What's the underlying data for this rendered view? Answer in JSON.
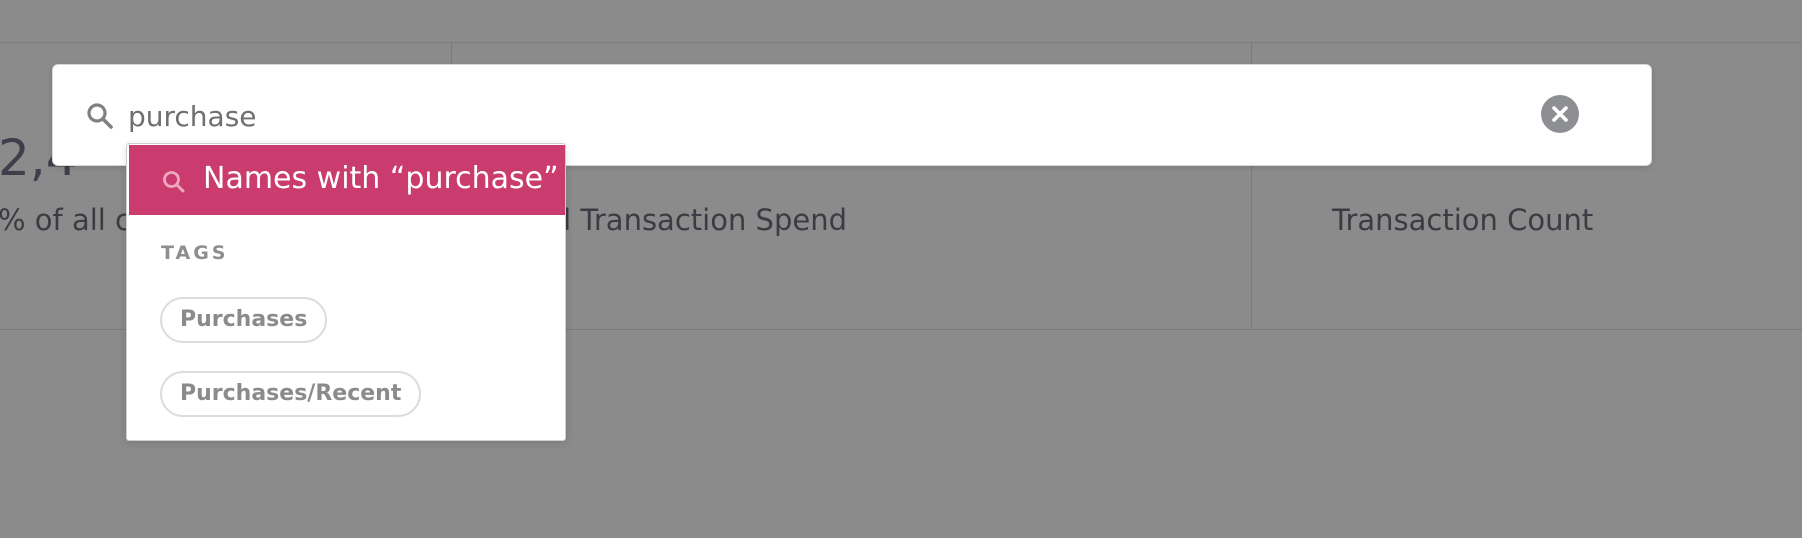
{
  "background": {
    "stats": [
      {
        "value": "2,4",
        "label": "% of all co"
      },
      {
        "value": "",
        "label": "tal Transaction Spend"
      },
      {
        "value": "",
        "label": "Transaction Count"
      }
    ]
  },
  "search": {
    "value": "purchase",
    "placeholder": ""
  },
  "dropdown": {
    "suggestion": "Names with “purchase”",
    "tags_heading": "TAGS",
    "tags": [
      "Purchases",
      "Purchases/Recent"
    ]
  },
  "colors": {
    "accent": "#c93c6d",
    "overlay": "#8a8b8a"
  },
  "icons": {
    "search": "search-icon",
    "clear": "clear-circle-icon"
  }
}
